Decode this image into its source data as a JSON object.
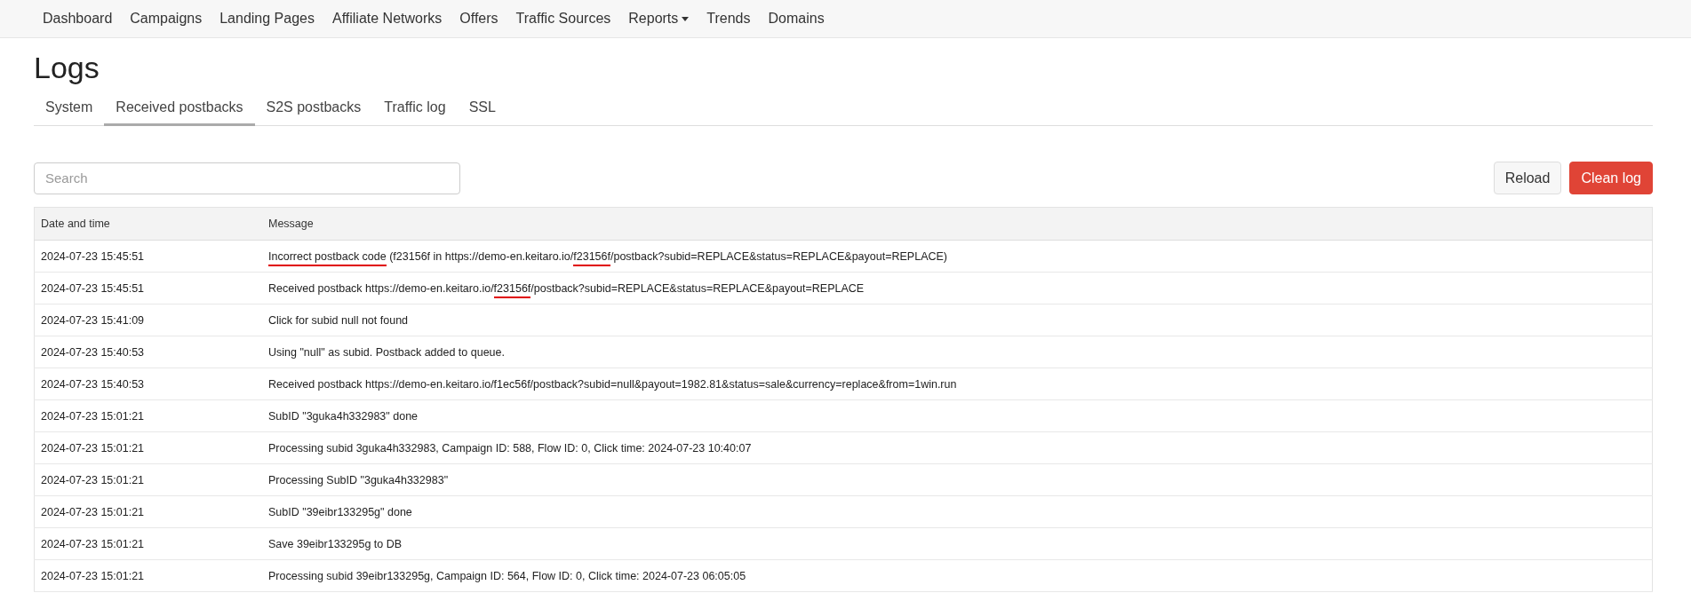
{
  "nav": [
    {
      "label": "Dashboard",
      "dropdown": false
    },
    {
      "label": "Campaigns",
      "dropdown": false
    },
    {
      "label": "Landing Pages",
      "dropdown": false
    },
    {
      "label": "Affiliate Networks",
      "dropdown": false
    },
    {
      "label": "Offers",
      "dropdown": false
    },
    {
      "label": "Traffic Sources",
      "dropdown": false
    },
    {
      "label": "Reports",
      "dropdown": true
    },
    {
      "label": "Trends",
      "dropdown": false
    },
    {
      "label": "Domains",
      "dropdown": false
    }
  ],
  "page_title": "Logs",
  "tabs": [
    {
      "label": "System",
      "selected": false
    },
    {
      "label": "Received postbacks",
      "selected": true
    },
    {
      "label": "S2S postbacks",
      "selected": false
    },
    {
      "label": "Traffic log",
      "selected": false
    },
    {
      "label": "SSL",
      "selected": false
    }
  ],
  "search": {
    "placeholder": "Search"
  },
  "buttons": [
    {
      "label": "Reload",
      "kind": "default"
    },
    {
      "label": "Clean log",
      "kind": "danger"
    }
  ],
  "table": {
    "columns": [
      "Date and time",
      "Message"
    ],
    "rows": [
      {
        "date": "2024-07-23 15:45:51",
        "message": [
          {
            "text": "Incorrect postback code",
            "underlined": true
          },
          {
            "text": " (f23156f in https://demo-en.keitaro.io/",
            "underlined": false
          },
          {
            "text": "f23156f",
            "underlined": true
          },
          {
            "text": "/postback?subid=REPLACE&status=REPLACE&payout=REPLACE)",
            "underlined": false
          }
        ]
      },
      {
        "date": "2024-07-23 15:45:51",
        "message": [
          {
            "text": "Received postback https://demo-en.keitaro.io/",
            "underlined": false
          },
          {
            "text": "f23156f",
            "underlined": true
          },
          {
            "text": "/postback?subid=REPLACE&status=REPLACE&payout=REPLACE",
            "underlined": false
          }
        ]
      },
      {
        "date": "2024-07-23 15:41:09",
        "message": [
          {
            "text": "Click for subid null not found",
            "underlined": false
          }
        ]
      },
      {
        "date": "2024-07-23 15:40:53",
        "message": [
          {
            "text": "Using \"null\" as subid. Postback added to queue.",
            "underlined": false
          }
        ]
      },
      {
        "date": "2024-07-23 15:40:53",
        "message": [
          {
            "text": "Received postback https://demo-en.keitaro.io/f1ec56f/postback?subid=null&payout=1982.81&status=sale&currency=replace&from=1win.run",
            "underlined": false
          }
        ]
      },
      {
        "date": "2024-07-23 15:01:21",
        "message": [
          {
            "text": "SubID \"3guka4h332983\" done",
            "underlined": false
          }
        ]
      },
      {
        "date": "2024-07-23 15:01:21",
        "message": [
          {
            "text": "Processing subid 3guka4h332983, Campaign ID: 588, Flow ID: 0, Click time: 2024-07-23 10:40:07",
            "underlined": false
          }
        ]
      },
      {
        "date": "2024-07-23 15:01:21",
        "message": [
          {
            "text": "Processing SubID \"3guka4h332983\"",
            "underlined": false
          }
        ]
      },
      {
        "date": "2024-07-23 15:01:21",
        "message": [
          {
            "text": "SubID \"39eibr133295g\" done",
            "underlined": false
          }
        ]
      },
      {
        "date": "2024-07-23 15:01:21",
        "message": [
          {
            "text": "Save 39eibr133295g to DB",
            "underlined": false
          }
        ]
      },
      {
        "date": "2024-07-23 15:01:21",
        "message": [
          {
            "text": "Processing subid 39eibr133295g, Campaign ID: 564, Flow ID: 0, Click time: 2024-07-23 06:05:05",
            "underlined": false
          }
        ]
      }
    ]
  }
}
